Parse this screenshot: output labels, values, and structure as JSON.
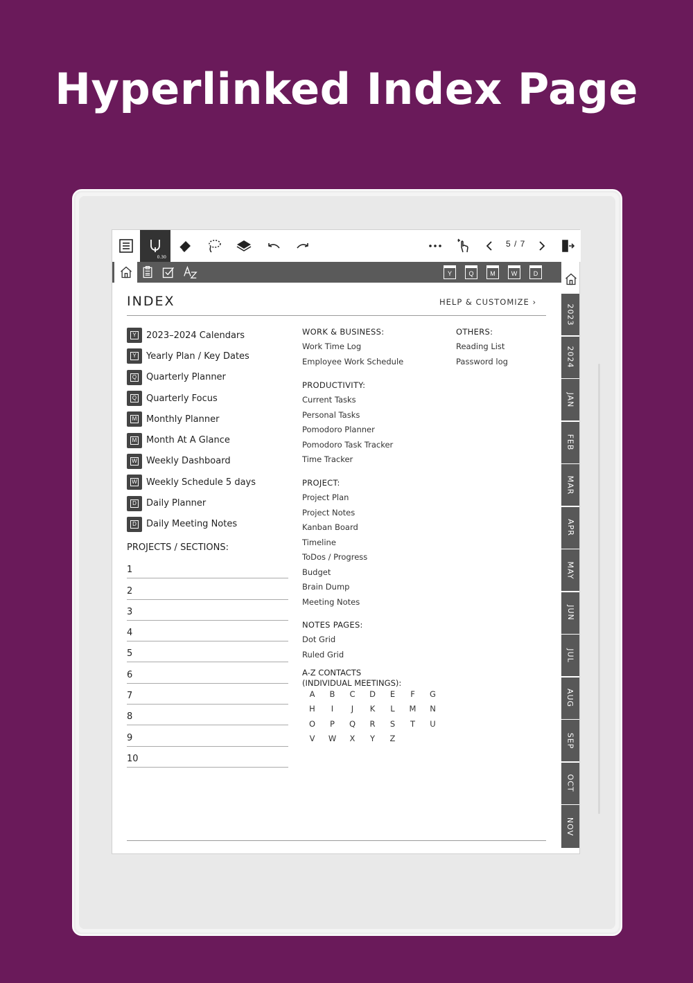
{
  "hero_title": "Hyperlinked Index Page",
  "toolbar": {
    "pen_size": "0.30",
    "page_indicator": "5 / 7"
  },
  "nav": {
    "shortcuts": [
      "Y",
      "Q",
      "M",
      "W",
      "D"
    ]
  },
  "tabs": [
    "2023",
    "2024",
    "JAN",
    "FEB",
    "MAR",
    "APR",
    "MAY",
    "JUN",
    "JUL",
    "AUG",
    "SEP",
    "OCT",
    "NOV"
  ],
  "index": {
    "title": "INDEX",
    "help": "HELP & CUSTOMIZE  ›",
    "main_items": [
      {
        "icon": "Y",
        "label": "2023–2024 Calendars"
      },
      {
        "icon": "Y",
        "label": "Yearly Plan / Key Dates"
      },
      {
        "icon": "Q",
        "label": "Quarterly Planner"
      },
      {
        "icon": "Q",
        "label": "Quarterly Focus"
      },
      {
        "icon": "M",
        "label": "Monthly Planner"
      },
      {
        "icon": "M",
        "label": "Month At A Glance"
      },
      {
        "icon": "W",
        "label": "Weekly Dashboard"
      },
      {
        "icon": "W",
        "label": "Weekly Schedule 5 days"
      },
      {
        "icon": "D",
        "label": "Daily Planner"
      },
      {
        "icon": "D",
        "label": "Daily Meeting Notes"
      }
    ],
    "projects_heading": "PROJECTS / SECTIONS:",
    "projects": [
      "1",
      "2",
      "3",
      "4",
      "5",
      "6",
      "7",
      "8",
      "9",
      "10"
    ],
    "work_business": {
      "heading": "WORK & BUSINESS:",
      "items": [
        "Work Time Log",
        "Employee Work Schedule"
      ]
    },
    "productivity": {
      "heading": "PRODUCTIVITY:",
      "items": [
        "Current Tasks",
        "Personal Tasks",
        "Pomodoro Planner",
        "Pomodoro Task Tracker",
        "Time Tracker"
      ]
    },
    "project": {
      "heading": "PROJECT:",
      "items": [
        "Project Plan",
        "Project Notes",
        "Kanban Board",
        "Timeline",
        "ToDos / Progress",
        "Budget",
        "Brain Dump",
        "Meeting Notes"
      ]
    },
    "notes_pages": {
      "heading": "NOTES PAGES:",
      "items": [
        "Dot Grid",
        "Ruled Grid"
      ]
    },
    "contacts": {
      "heading_line1": "A-Z CONTACTS",
      "heading_line2": "(INDIVIDUAL MEETINGS):",
      "rows": [
        [
          "A",
          "B",
          "C",
          "D",
          "E",
          "F",
          "G"
        ],
        [
          "H",
          "I",
          "J",
          "K",
          "L",
          "M",
          "N"
        ],
        [
          "O",
          "P",
          "Q",
          "R",
          "S",
          "T",
          "U"
        ],
        [
          "V",
          "W",
          "X",
          "Y",
          "Z"
        ]
      ]
    },
    "others": {
      "heading": "OTHERS:",
      "items": [
        "Reading List",
        "Password log"
      ]
    }
  }
}
